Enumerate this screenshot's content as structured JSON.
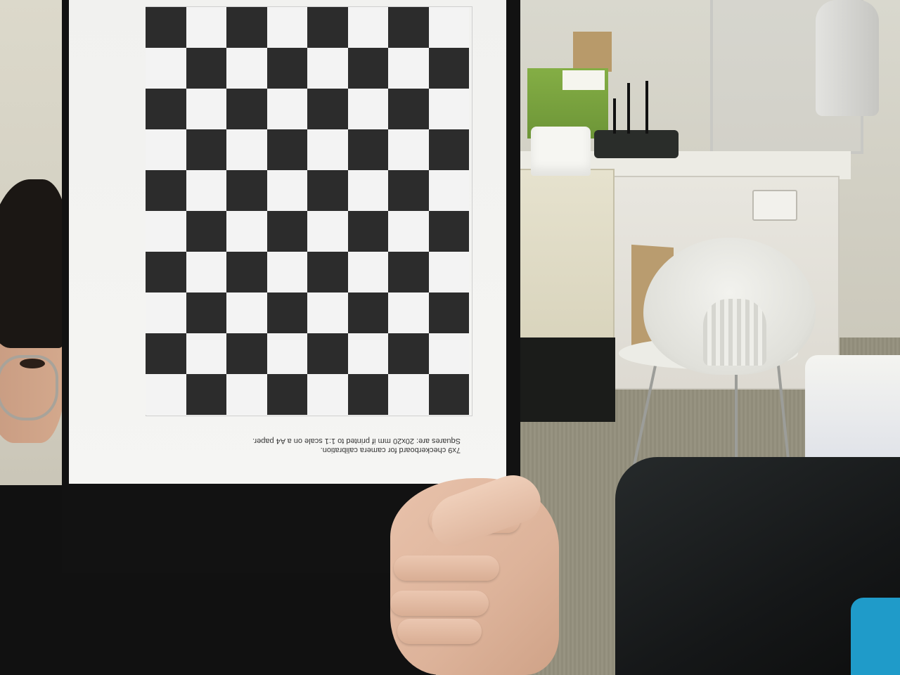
{
  "photo": {
    "checkerboard": {
      "columns": 8,
      "rows": 10,
      "dark_color": "#2c2c2c",
      "light_color": "#f3f3f3"
    },
    "caption_lines": [
      "7x9 checkerboard for camera calibration.",
      "Squares are: 20x20 mm if printed to 1:1 scale on a A4 paper."
    ]
  }
}
